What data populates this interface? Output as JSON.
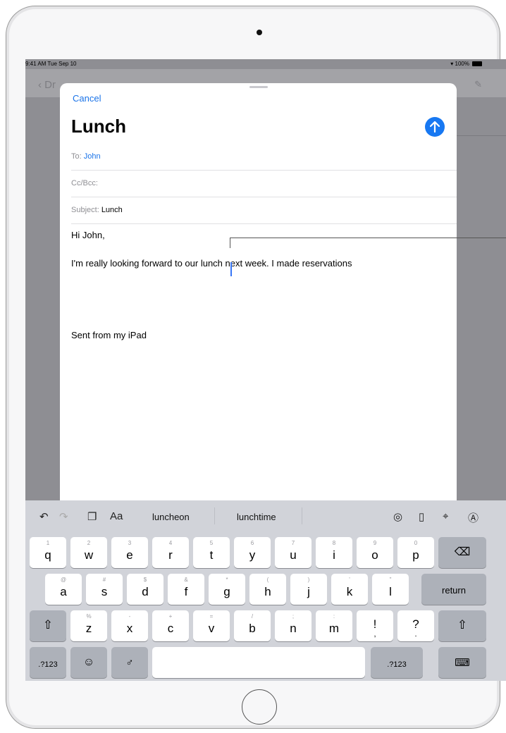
{
  "status_bar": {
    "time_date": "9:41 AM  Tue Sep 10",
    "battery": "100%"
  },
  "background_mail": {
    "back_label": "Dr"
  },
  "compose": {
    "cancel_label": "Cancel",
    "title": "Lunch",
    "to_label": "To:",
    "to_value": "John",
    "cc_label": "Cc/Bcc:",
    "subject_label": "Subject:",
    "subject_value": "Lunch",
    "greeting": "Hi John,",
    "body_line": "I'm really looking forward to our lunch next week. I made reservations",
    "signature": "Sent from my iPad"
  },
  "keyboard": {
    "shortcuts": {
      "format_label": "Aa"
    },
    "suggestions": [
      "luncheon",
      "lunchtime"
    ],
    "row1": [
      {
        "k": "q",
        "s": "1"
      },
      {
        "k": "w",
        "s": "2"
      },
      {
        "k": "e",
        "s": "3"
      },
      {
        "k": "r",
        "s": "4"
      },
      {
        "k": "t",
        "s": "5"
      },
      {
        "k": "y",
        "s": "6"
      },
      {
        "k": "u",
        "s": "7"
      },
      {
        "k": "i",
        "s": "8"
      },
      {
        "k": "o",
        "s": "9"
      },
      {
        "k": "p",
        "s": "0"
      }
    ],
    "row2": [
      {
        "k": "a",
        "s": "@"
      },
      {
        "k": "s",
        "s": "#"
      },
      {
        "k": "d",
        "s": "$"
      },
      {
        "k": "f",
        "s": "&"
      },
      {
        "k": "g",
        "s": "*"
      },
      {
        "k": "h",
        "s": "("
      },
      {
        "k": "j",
        "s": ")"
      },
      {
        "k": "k",
        "s": "'"
      },
      {
        "k": "l",
        "s": "\""
      }
    ],
    "row3": [
      {
        "k": "z",
        "s": "%"
      },
      {
        "k": "x",
        "s": "-"
      },
      {
        "k": "c",
        "s": "+"
      },
      {
        "k": "v",
        "s": "="
      },
      {
        "k": "b",
        "s": "/"
      },
      {
        "k": "n",
        "s": ";"
      },
      {
        "k": "m",
        "s": ":"
      },
      {
        "k": "!",
        "s": ""
      },
      {
        "k": "?",
        "s": ""
      }
    ],
    "row3_extra": {
      "excl_secondary": ",",
      "quest_secondary": "."
    },
    "return_label": "return",
    "numbers_label": ".?123"
  },
  "colors": {
    "accent": "#1a73e8",
    "send_button": "#1778f2",
    "keyboard_bg": "#d1d3d9",
    "dimmed_background": "#8e8e93"
  },
  "icons": [
    "undo-icon",
    "redo-icon",
    "paste-icon",
    "camera-icon",
    "document-icon",
    "scan-icon",
    "markup-icon",
    "delete-icon",
    "shift-icon",
    "emoji-icon",
    "microphone-icon",
    "keyboard-dismiss-icon",
    "send-arrow-icon",
    "wifi-icon",
    "battery-icon"
  ]
}
